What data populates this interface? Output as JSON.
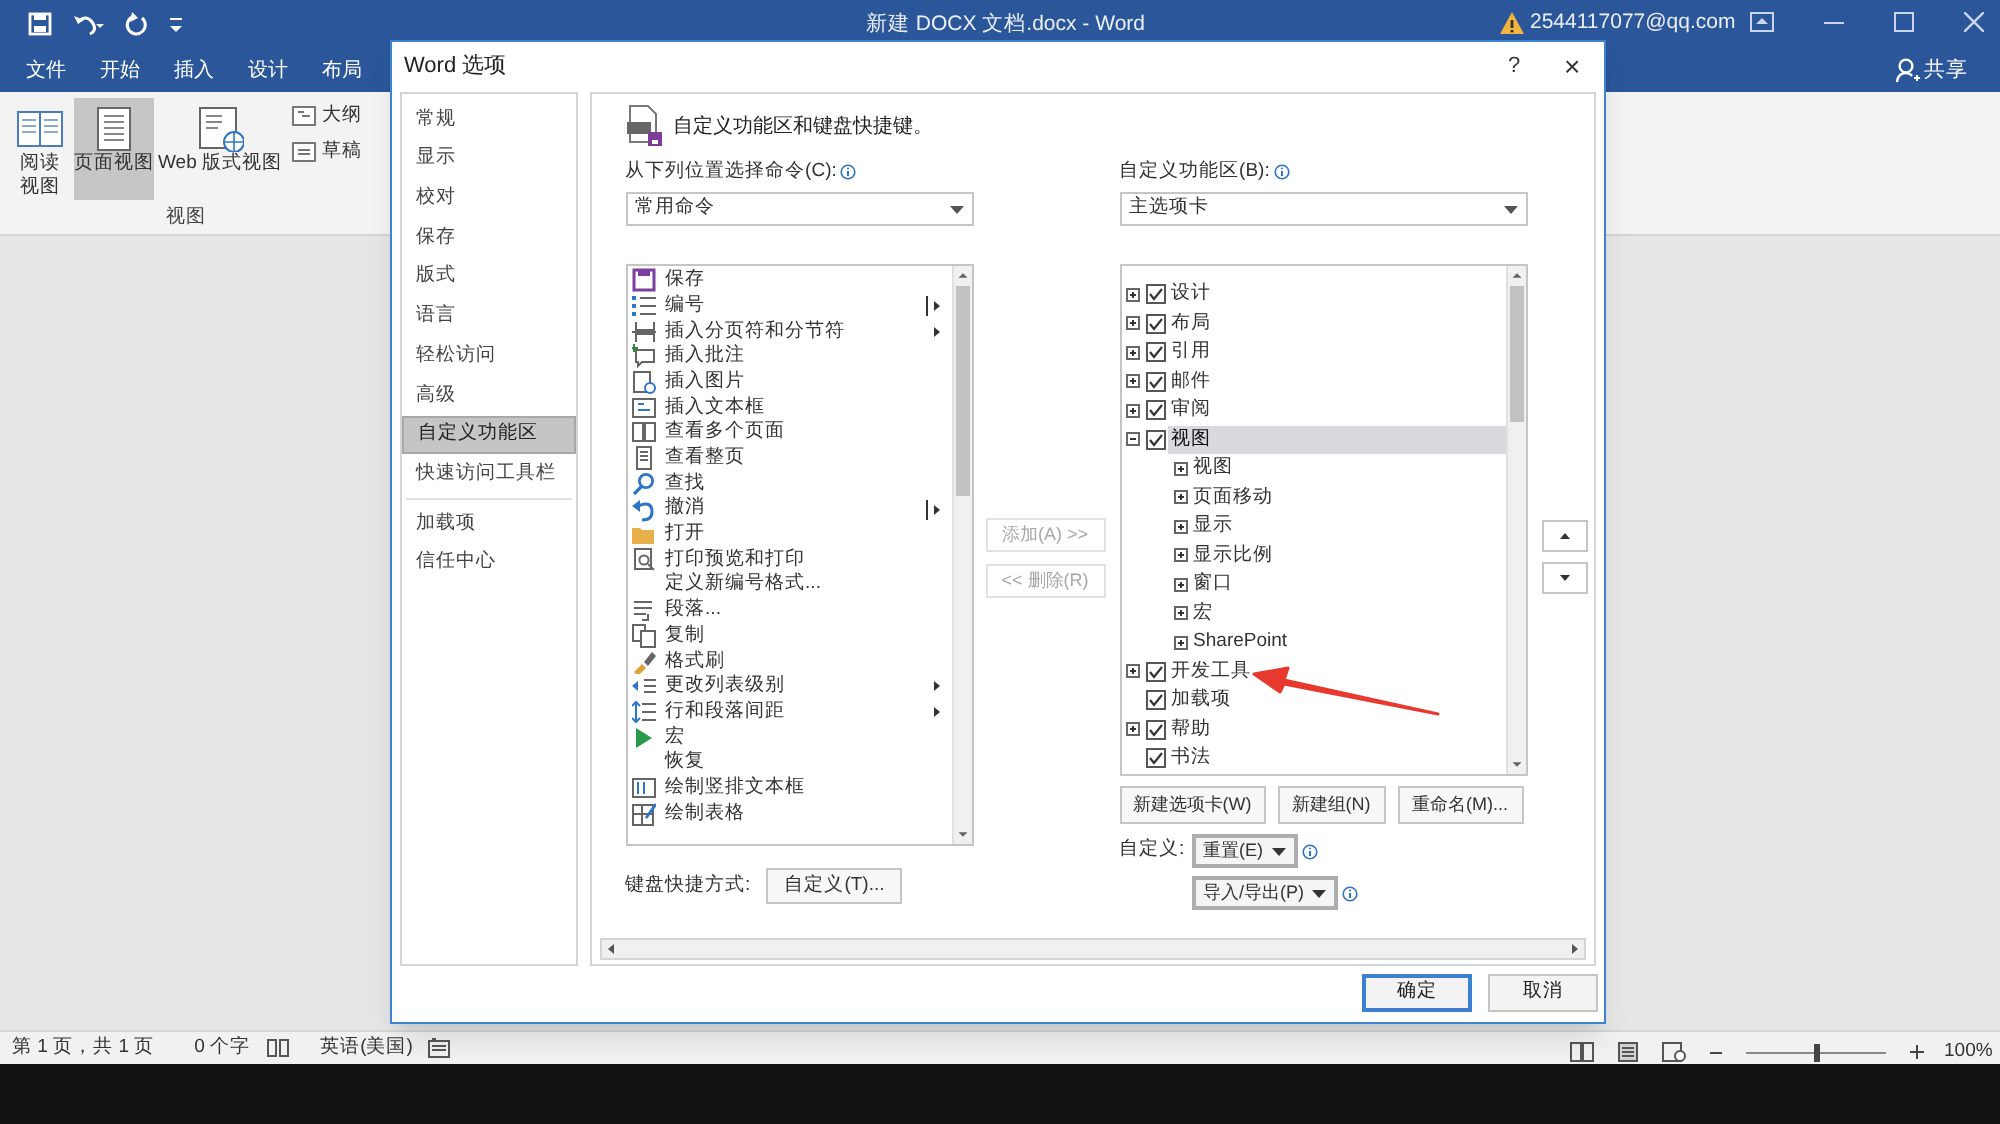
{
  "window": {
    "title": "新建 DOCX 文档.docx - Word",
    "account": "2544117077@qq.com",
    "tabs": [
      "文件",
      "开始",
      "插入",
      "设计",
      "布局"
    ],
    "share": "共享"
  },
  "ribbon": {
    "buttons": [
      {
        "label": "阅读视图",
        "selected": false
      },
      {
        "label": "页面视图",
        "selected": true
      },
      {
        "label": "Web 版式视图",
        "selected": false
      }
    ],
    "small_buttons": [
      "大纲",
      "草稿"
    ],
    "group_label": "视图"
  },
  "dialog": {
    "title": "Word 选项",
    "help": "?",
    "close": "×",
    "sidebar": {
      "groups": [
        {
          "items": [
            {
              "label": "常规",
              "selected": false
            },
            {
              "label": "显示",
              "selected": false
            },
            {
              "label": "校对",
              "selected": false
            },
            {
              "label": "保存",
              "selected": false
            },
            {
              "label": "版式",
              "selected": false
            },
            {
              "label": "语言",
              "selected": false
            },
            {
              "label": "轻松访问",
              "selected": false
            },
            {
              "label": "高级",
              "selected": false
            },
            {
              "label": "自定义功能区",
              "selected": true
            },
            {
              "label": "快速访问工具栏",
              "selected": false
            }
          ]
        },
        {
          "items": [
            {
              "label": "加载项",
              "selected": false
            },
            {
              "label": "信任中心",
              "selected": false
            }
          ]
        }
      ]
    },
    "header": "自定义功能区和键盘快捷键。",
    "commands": {
      "label": "从下列位置选择命令(C):",
      "dropdown": "常用命令",
      "items": [
        {
          "label": "保存",
          "kind": "plain"
        },
        {
          "label": "编号",
          "kind": "split"
        },
        {
          "label": "插入分页符和分节符",
          "kind": "submenu"
        },
        {
          "label": "插入批注",
          "kind": "plain"
        },
        {
          "label": "插入图片",
          "kind": "plain"
        },
        {
          "label": "插入文本框",
          "kind": "plain"
        },
        {
          "label": "查看多个页面",
          "kind": "plain"
        },
        {
          "label": "查看整页",
          "kind": "plain"
        },
        {
          "label": "查找",
          "kind": "plain"
        },
        {
          "label": "撤消",
          "kind": "split"
        },
        {
          "label": "打开",
          "kind": "plain"
        },
        {
          "label": "打印预览和打印",
          "kind": "plain"
        },
        {
          "label": "定义新编号格式...",
          "kind": "plain"
        },
        {
          "label": "段落...",
          "kind": "plain"
        },
        {
          "label": "复制",
          "kind": "plain"
        },
        {
          "label": "格式刷",
          "kind": "plain"
        },
        {
          "label": "更改列表级别",
          "kind": "submenu"
        },
        {
          "label": "行和段落间距",
          "kind": "submenu"
        },
        {
          "label": "宏",
          "kind": "plain"
        },
        {
          "label": "恢复",
          "kind": "plain"
        },
        {
          "label": "绘制竖排文本框",
          "kind": "plain"
        },
        {
          "label": "绘制表格",
          "kind": "plain"
        }
      ]
    },
    "shortcut": {
      "label": "键盘快捷方式:",
      "button": "自定义(T)..."
    },
    "add": {
      "label": "添加(A) >>",
      "disabled": true
    },
    "remove": {
      "label": "<< 删除(R)",
      "disabled": true
    },
    "ribbon_tabs": {
      "label": "自定义功能区(B):",
      "dropdown": "主选项卡",
      "tree": [
        {
          "label": "设计",
          "checked": true,
          "expanded": false,
          "selected": false
        },
        {
          "label": "布局",
          "checked": true,
          "expanded": false,
          "selected": false
        },
        {
          "label": "引用",
          "checked": true,
          "expanded": false,
          "selected": false
        },
        {
          "label": "邮件",
          "checked": true,
          "expanded": false,
          "selected": false
        },
        {
          "label": "审阅",
          "checked": true,
          "expanded": false,
          "selected": false
        },
        {
          "label": "视图",
          "checked": true,
          "expanded": true,
          "selected": true,
          "children": [
            {
              "label": "视图",
              "expanded": false,
              "selected": false
            },
            {
              "label": "页面移动",
              "expanded": false,
              "selected": false
            },
            {
              "label": "显示",
              "expanded": false,
              "selected": false
            },
            {
              "label": "显示比例",
              "expanded": false,
              "selected": false
            },
            {
              "label": "窗口",
              "expanded": false,
              "selected": false
            },
            {
              "label": "宏",
              "expanded": false,
              "selected": false
            },
            {
              "label": "SharePoint",
              "expanded": false,
              "selected": false
            }
          ]
        },
        {
          "label": "开发工具",
          "checked": true,
          "expanded": false,
          "selected": false
        },
        {
          "label": "加载项",
          "checked": true,
          "selected": false
        },
        {
          "label": "帮助",
          "checked": true,
          "expanded": false,
          "selected": false
        },
        {
          "label": "书法",
          "checked": true,
          "selected": false
        }
      ],
      "buttons": [
        "新建选项卡(W)",
        "新建组(N)",
        "重命名(M)..."
      ],
      "customize_label": "自定义:",
      "reset": "重置(E)",
      "import_export": "导入/导出(P)"
    },
    "ok": "确定",
    "cancel": "取消"
  },
  "status_bar": {
    "page": "第 1 页，共 1 页",
    "words": "0 个字",
    "language": "英语(美国)",
    "zoom": {
      "level": 0.5
    },
    "zoom_text": "100%"
  }
}
